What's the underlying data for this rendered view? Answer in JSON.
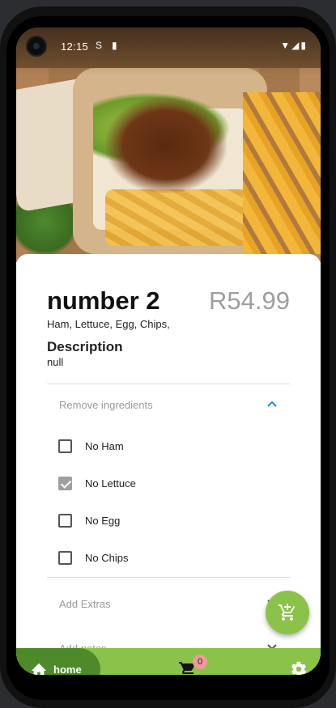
{
  "status_bar": {
    "time": "12:15",
    "icons": [
      "s-icon",
      "sd-card-icon",
      "wifi-icon",
      "signal-icon",
      "battery-icon"
    ]
  },
  "product": {
    "name": "number 2",
    "price": "R54.99",
    "ingredients": "Ham, Lettuce, Egg, Chips,",
    "description_heading": "Description",
    "description": "null"
  },
  "remove_section": {
    "label": "Remove ingredients",
    "expanded": true,
    "options": [
      {
        "label": "No Ham",
        "checked": false
      },
      {
        "label": "No Lettuce",
        "checked": true
      },
      {
        "label": "No Egg",
        "checked": false
      },
      {
        "label": "No Chips",
        "checked": false
      }
    ]
  },
  "extras_section": {
    "label": "Add Extras",
    "expanded": false
  },
  "notes_section": {
    "label": "Add notes",
    "expanded": false
  },
  "fab": {
    "icon": "add-to-cart-icon"
  },
  "bottom_nav": {
    "home_label": "home",
    "cart_count": "0",
    "icons": [
      "home-icon",
      "cart-icon",
      "gear-icon"
    ]
  },
  "colors": {
    "accent_green": "#8bc34a",
    "dark_green": "#4e8a2a",
    "price_grey": "#9e9e9e",
    "expand_blue": "#1e88e5",
    "badge_pink": "#ef9a9a"
  }
}
